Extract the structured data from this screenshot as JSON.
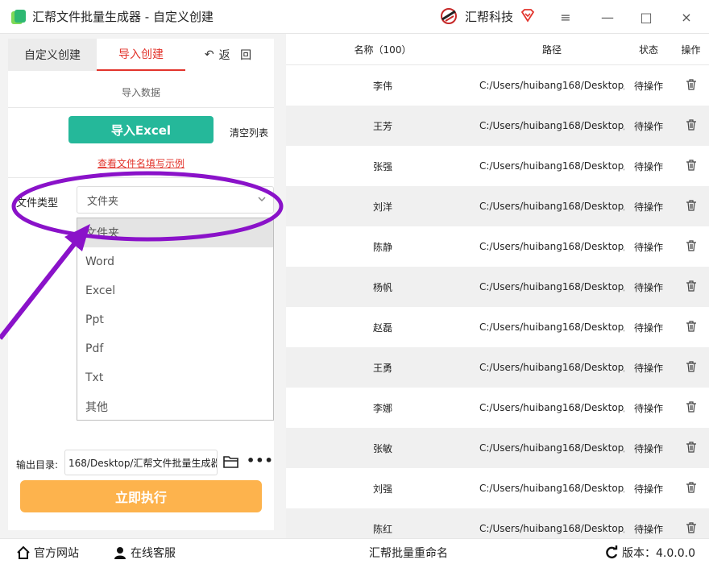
{
  "window": {
    "title": "汇帮文件批量生成器 - 自定义创建",
    "brand": "汇帮科技",
    "controls": [
      "≡",
      "—",
      "□",
      "×"
    ]
  },
  "left": {
    "tabs": [
      "自定义创建",
      "导入创建",
      "返  回"
    ],
    "back_arrow": "↶",
    "section_title": "导入数据",
    "import_button": "导入Excel",
    "clear_list": "清空列表",
    "example_link": "查看文件名填写示例",
    "file_type_label": "文件类型",
    "file_type_selected": "文件夹",
    "file_type_options": [
      "文件夹",
      "Word",
      "Excel",
      "Ppt",
      "Pdf",
      "Txt",
      "其他"
    ],
    "output_label": "输出目录:",
    "output_path": "168/Desktop/汇帮文件批量生成器",
    "more": "•••",
    "run_button": "立即执行"
  },
  "table": {
    "headers": {
      "name": "名称（100）",
      "path": "路径",
      "status": "状态",
      "op": "操作"
    },
    "rows": [
      {
        "name": "李伟",
        "path": "C:/Users/huibang168/Desktop/",
        "status": "待操作"
      },
      {
        "name": "王芳",
        "path": "C:/Users/huibang168/Desktop/",
        "status": "待操作"
      },
      {
        "name": "张强",
        "path": "C:/Users/huibang168/Desktop/",
        "status": "待操作"
      },
      {
        "name": "刘洋",
        "path": "C:/Users/huibang168/Desktop/",
        "status": "待操作"
      },
      {
        "name": "陈静",
        "path": "C:/Users/huibang168/Desktop/",
        "status": "待操作"
      },
      {
        "name": "杨帆",
        "path": "C:/Users/huibang168/Desktop/",
        "status": "待操作"
      },
      {
        "name": "赵磊",
        "path": "C:/Users/huibang168/Desktop/",
        "status": "待操作"
      },
      {
        "name": "王勇",
        "path": "C:/Users/huibang168/Desktop/",
        "status": "待操作"
      },
      {
        "name": "李娜",
        "path": "C:/Users/huibang168/Desktop/",
        "status": "待操作"
      },
      {
        "name": "张敏",
        "path": "C:/Users/huibang168/Desktop/",
        "status": "待操作"
      },
      {
        "name": "刘强",
        "path": "C:/Users/huibang168/Desktop/",
        "status": "待操作"
      },
      {
        "name": "陈红",
        "path": "C:/Users/huibang168/Desktop/",
        "status": "待操作"
      }
    ]
  },
  "footer": {
    "website": "官方网站",
    "support": "在线客服",
    "center": "汇帮批量重命名",
    "version": "版本：4.0.0.0"
  },
  "colors": {
    "accent_red": "#e2342c",
    "import_green": "#25b89a",
    "run_orange": "#fdb34d",
    "annotation_purple": "#8a12c9"
  }
}
